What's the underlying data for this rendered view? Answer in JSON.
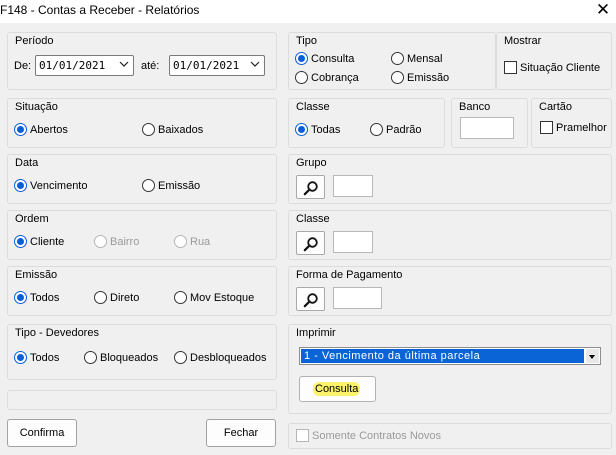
{
  "window": {
    "title": "F148 - Contas a Receber - Relatórios",
    "close_label": "✕"
  },
  "periodo": {
    "label": "Período",
    "from_label": "De:",
    "from_value": "01/01/2021",
    "to_label": "até:",
    "to_value": "01/01/2021"
  },
  "tipo": {
    "label": "Tipo",
    "options": [
      "Consulta",
      "Mensal",
      "Cobrança",
      "Emissão"
    ],
    "selected": "Consulta"
  },
  "mostrar": {
    "label": "Mostrar",
    "checkbox_label": "Situação Cliente",
    "checked": false
  },
  "situacao": {
    "label": "Situação",
    "options": [
      "Abertos",
      "Baixados"
    ],
    "selected": "Abertos"
  },
  "classe_radio": {
    "label": "Classe",
    "options": [
      "Todas",
      "Padrão"
    ],
    "selected": "Todas"
  },
  "banco": {
    "label": "Banco",
    "value": ""
  },
  "cartao": {
    "label": "Cartão",
    "checkbox_label": "Pramelhor",
    "checked": false
  },
  "data": {
    "label": "Data",
    "options": [
      "Vencimento",
      "Emissão"
    ],
    "selected": "Vencimento"
  },
  "grupo": {
    "label": "Grupo",
    "value": ""
  },
  "ordem": {
    "label": "Ordem",
    "options": [
      "Cliente",
      "Bairro",
      "Rua"
    ],
    "selected": "Cliente",
    "disabled": [
      "Bairro",
      "Rua"
    ]
  },
  "classe_lookup": {
    "label": "Classe",
    "value": ""
  },
  "emissao": {
    "label": "Emissão",
    "options": [
      "Todos",
      "Direto",
      "Mov Estoque"
    ],
    "selected": "Todos"
  },
  "forma_pagamento": {
    "label": "Forma de Pagamento",
    "value": ""
  },
  "tipo_devedores": {
    "label": "Tipo - Devedores",
    "options": [
      "Todos",
      "Bloqueados",
      "Desbloqueados"
    ],
    "selected": "Todos"
  },
  "imprimir": {
    "label": "Imprimir",
    "selected_value": "1 - Vencimento da última parcela",
    "button_label": "Consulta"
  },
  "footer": {
    "confirm_label": "Confirma",
    "close_label": "Fechar",
    "contracts_label": "Somente Contratos Novos",
    "contracts_checked": false
  },
  "colors": {
    "accent": "#0a64d6",
    "highlight": "#fbf36b",
    "window_bg": "#f0f0f0"
  },
  "icons": [
    "close-icon",
    "calendar-dropdown-icon",
    "search-icon"
  ]
}
